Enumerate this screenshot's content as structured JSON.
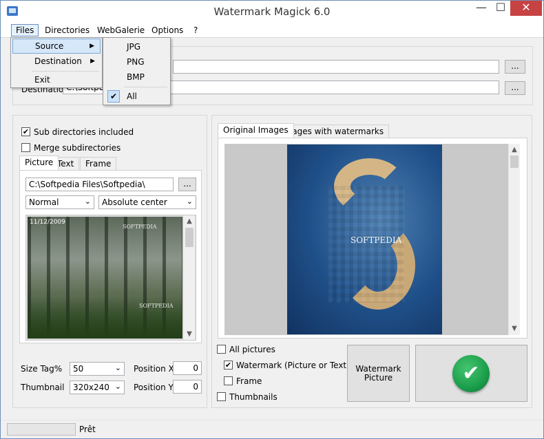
{
  "window": {
    "title": "Watermark Magick 6.0",
    "controls": {
      "minimize": "—",
      "maximize": "☐",
      "close": "✕"
    }
  },
  "menubar": {
    "items": [
      {
        "label": "Files"
      },
      {
        "label": "Directories"
      },
      {
        "label": "WebGalerie"
      },
      {
        "label": "Options"
      },
      {
        "label": "?"
      }
    ]
  },
  "files_menu": {
    "items": [
      "Source",
      "Destination",
      "Exit"
    ],
    "submenu_arrow": "▶"
  },
  "source_submenu": {
    "items": [
      "JPG",
      "PNG",
      "BMP",
      "All"
    ],
    "checked": "All",
    "check_glyph": "✔"
  },
  "paths": {
    "source_value": "",
    "source_button": "...",
    "destination_label": "Destination",
    "destination_value": "C:\\Softpedia Files\\Softp\\",
    "destination_button": "..."
  },
  "left_panel": {
    "sub_directories_label": "Sub directories included",
    "sub_directories_checked": true,
    "merge_label": "Merge subdirectories",
    "merge_checked": false,
    "tabs": [
      "Picture",
      "Text",
      "Frame"
    ],
    "active_tab": "Picture",
    "picture_path": "C:\\Softpedia Files\\Softpedia\\",
    "picture_browse": "...",
    "blend_mode": "Normal",
    "position_mode": "Absolute center",
    "preview_caption": "11/12/2009",
    "preview_watermark": "SOFTPEDIA",
    "size_tag_label": "Size Tag%",
    "size_tag_value": "50",
    "thumbnail_label": "Thumbnail",
    "thumbnail_value": "320x240",
    "position_x_label": "Position X",
    "position_x_value": "0",
    "position_y_label": "Position Y",
    "position_y_value": "0"
  },
  "right_panel": {
    "tabs": [
      "Original Images",
      "Images with watermarks"
    ],
    "active_tab": "Original Images",
    "image_watermark": "SOFTPEDIA",
    "all_pictures_label": "All pictures",
    "all_pictures_checked": false,
    "watermark_label": "Watermark (Picture or Text)",
    "watermark_checked": true,
    "frame_label": "Frame",
    "frame_checked": false,
    "thumbnails_label": "Thumbnails",
    "thumbnails_checked": false,
    "watermark_picture_button": "Watermark Picture",
    "go_icon": "✔"
  },
  "status": {
    "progress_fraction": 0,
    "text": "Prêt"
  },
  "scroll": {
    "up": "▲",
    "down": "▼"
  },
  "colors": {
    "accent": "#3b78c8",
    "close_button": "#c74242",
    "go_button": "#1b9e4b",
    "menu_highlight": "#d5e7f8"
  }
}
